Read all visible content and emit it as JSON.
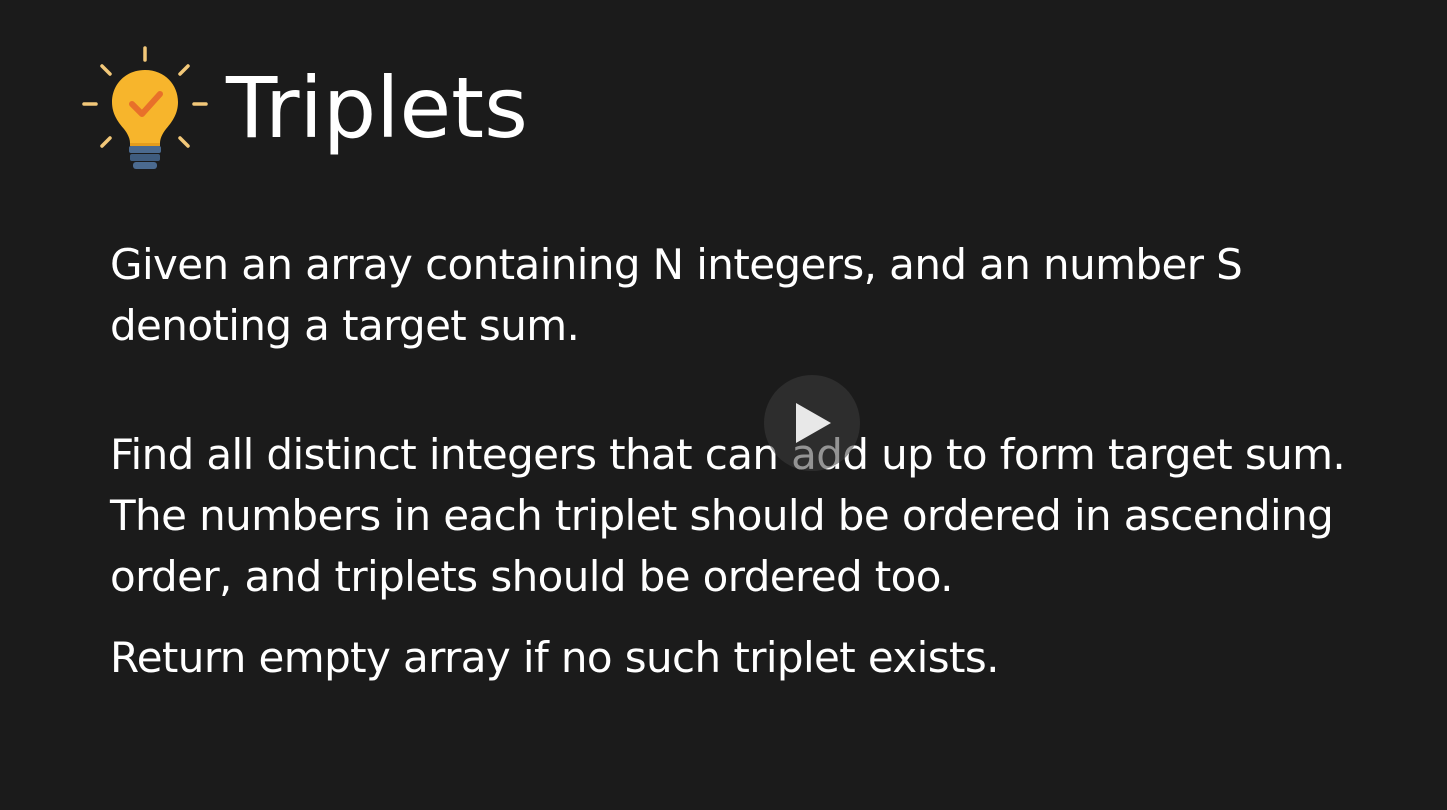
{
  "slide": {
    "title": "Triplets",
    "paragraphs": [
      "Given an array containing N integers, and an number S denoting a target sum.",
      "Find all distinct integers that can add up to form target sum. The numbers in each triplet should be ordered in ascending order, and triplets should be ordered too.",
      "Return empty array if no such triplet exists."
    ]
  },
  "icons": {
    "title_icon": "lightbulb-check-icon",
    "overlay_icon": "play-icon"
  },
  "colors": {
    "background": "#1b1b1b",
    "text": "#ffffff",
    "bulb": "#f7b52c",
    "bulb_base": "#4b6a8f",
    "check": "#e8702a"
  }
}
